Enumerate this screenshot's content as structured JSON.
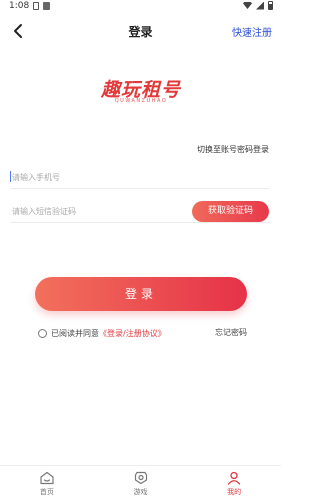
{
  "status_bar": {
    "time": "1:08"
  },
  "header": {
    "title": "登录",
    "quick_register": "快速注册"
  },
  "logo": {
    "main": "趣玩租号",
    "sub": "QUWANZUHAO"
  },
  "switch_mode": "切换至账号密码登录",
  "phone_input": {
    "placeholder": "请输入手机号",
    "value": ""
  },
  "code_input": {
    "placeholder": "请输入短信验证码",
    "value": ""
  },
  "get_code_button": "获取验证码",
  "login_button": "登录",
  "agreement": {
    "prefix": "已阅读并同意",
    "link": "《登录/注册协议》",
    "checked": false
  },
  "forgot_password": "忘记密码",
  "tabbar": {
    "items": [
      {
        "label": "首页",
        "icon": "home-icon",
        "active": false
      },
      {
        "label": "游戏",
        "icon": "game-icon",
        "active": false
      },
      {
        "label": "我的",
        "icon": "user-icon",
        "active": true
      }
    ]
  },
  "colors": {
    "accent": "#e63248",
    "link_blue": "#2a4fd6"
  }
}
